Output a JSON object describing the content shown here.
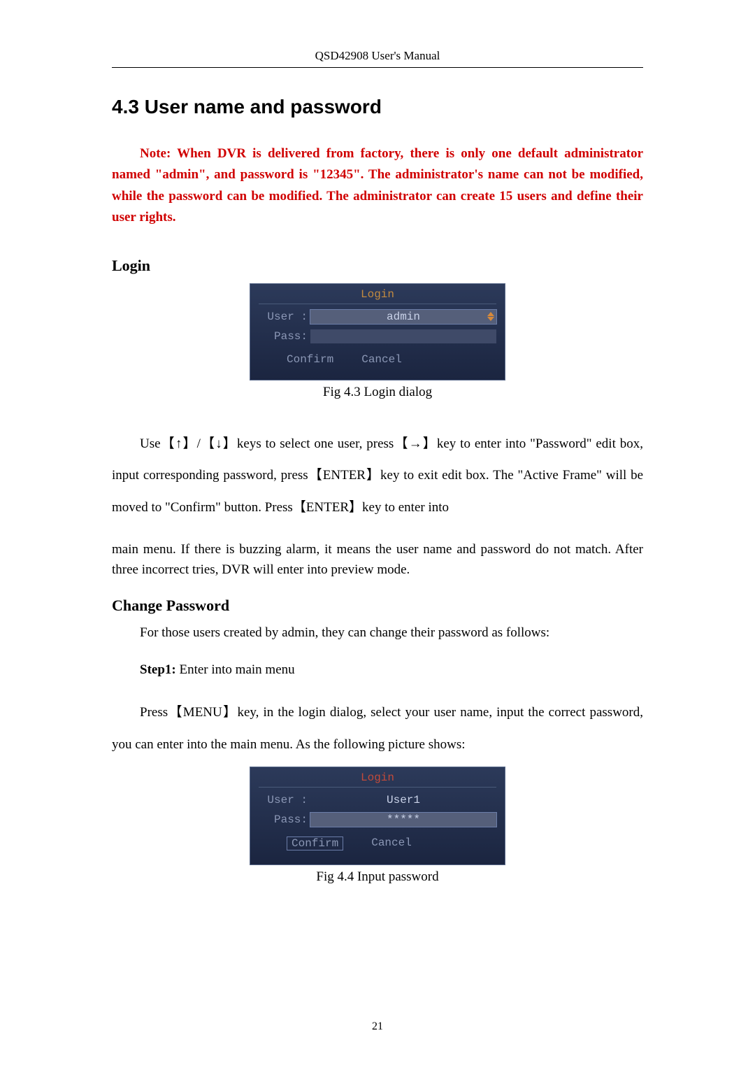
{
  "header": "QSD42908 User's Manual",
  "section_title": "4.3 User name and password",
  "note_text": "Note: When DVR is delivered from factory, there is only one default administrator named \"admin\", and password is \"12345\". The administrator's name can not be modified, while the password can be modified. The administrator can create 15 users and define their user rights.",
  "login_heading": "Login",
  "fig43": {
    "title": "Login",
    "user_label": "User :",
    "user_value": "admin",
    "pass_label": "Pass:",
    "pass_value": "",
    "confirm": "Confirm",
    "cancel": "Cancel",
    "caption": "Fig 4.3 Login dialog"
  },
  "instruction1": "Use【↑】/【↓】keys to select one user, press【→】key to enter into \"Password\" edit box, input corresponding password, press【ENTER】key to exit edit box. The \"Active Frame\" will be moved to \"Confirm\" button. Press【ENTER】key to enter into",
  "instruction1_cont": "main menu. If there is buzzing alarm, it means the user name and password do not match. After three incorrect tries, DVR will enter into preview mode.",
  "change_heading": "Change Password",
  "change_p1": "For those users created by admin, they can change their password as follows:",
  "step1_label": "Step1: ",
  "step1_text": "Enter into main menu",
  "step1_body": "Press【MENU】key, in the login dialog, select your user name, input the correct password, you can enter into the main menu. As the following picture shows:",
  "fig44": {
    "title": "Login",
    "user_label": "User :",
    "user_value": "User1",
    "pass_label": "Pass:",
    "pass_value": "*****",
    "confirm": "Confirm",
    "cancel": "Cancel",
    "caption": "Fig 4.4 Input password"
  },
  "page_number": "21"
}
